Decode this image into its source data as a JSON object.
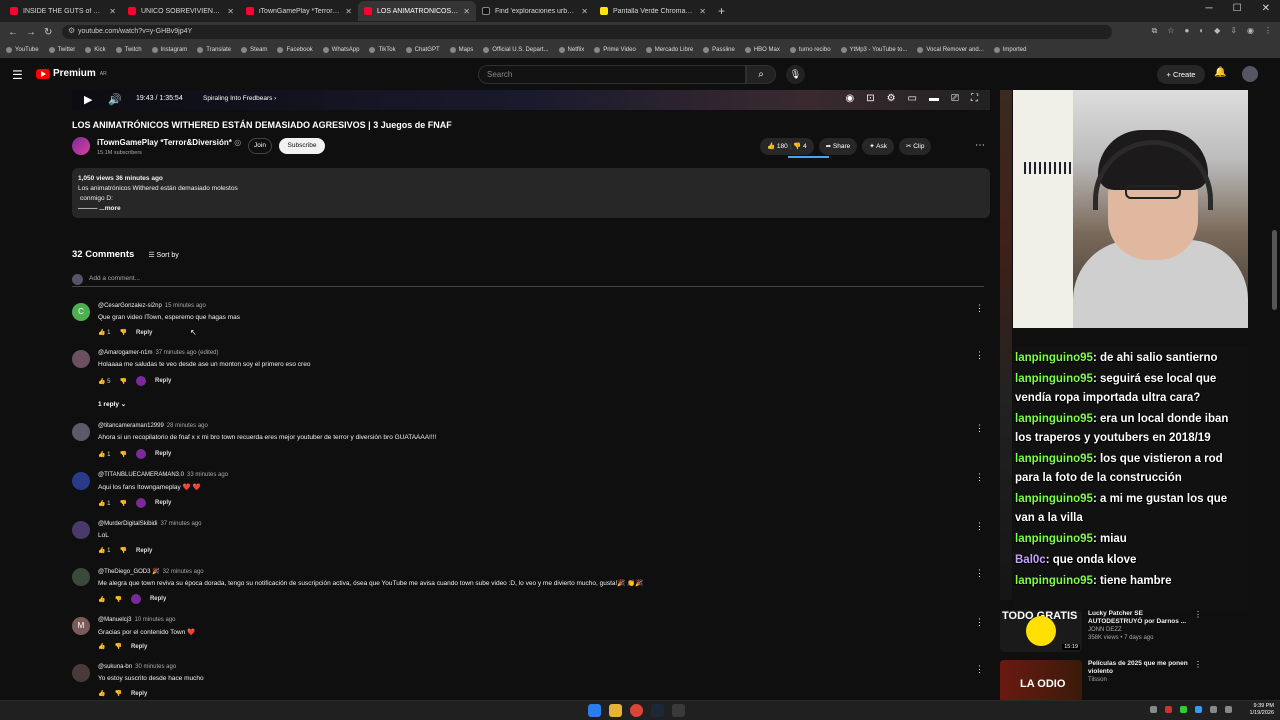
{
  "browser": {
    "tabs": [
      {
        "label": "INSIDE THE GUTS of THE CRAZ",
        "active": false
      },
      {
        "label": "UNICO SOBREVIVIENTE | ATRAP",
        "active": false
      },
      {
        "label": "iTownGamePlay *Terror&Diver",
        "active": false
      },
      {
        "label": "LOS ANIMATRÓNICOS WIT",
        "active": true
      },
      {
        "label": "Find 'exploraciones urbanas' or",
        "active": false
      },
      {
        "label": "Pantalla Verde Chroma | Merca",
        "active": false
      }
    ],
    "new_tab": "+",
    "url": "youtube.com/watch?v=y-GHBv9jp4Y",
    "bookmarks": [
      "YouTube",
      "Twitter",
      "Kick",
      "Twitch",
      "Instagram",
      "Translate",
      "Steam",
      "Facebook",
      "WhatsApp",
      "TikTok",
      "ChatGPT",
      "Maps",
      "Official U.S. Depart...",
      "Netflix",
      "Prime Video",
      "Mercado Libre",
      "Passline",
      "HBO Max",
      "turno recibo",
      "YtMp3 - YouTube to...",
      "Vocal Remover and...",
      "Imported"
    ]
  },
  "youtube": {
    "logo_text": "Premium",
    "logo_sup": "AR",
    "search_placeholder": "Search",
    "create_label": "+ Create"
  },
  "player": {
    "time": "19:43 / 1:35:54",
    "chapter": "Spiraling Into Fredbears ›"
  },
  "video": {
    "title": "LOS ANIMATRÓNICOS WITHERED ESTÁN DEMASIADO AGRESIVOS | 3 Juegos de FNAF",
    "channel": "iTownGamePlay *Terror&Diversión*",
    "verified": "◎",
    "subscribers": "15.1M subscribers",
    "join_label": "Join",
    "subscribe_label": "Subscribe",
    "likes": "180",
    "dislikes": "4",
    "share_label": "Share",
    "ask_label": "Ask",
    "clip_label": "Clip",
    "views_line": "1,050 views  36 minutes ago",
    "desc_line1": "Los animatrónicos Withered están demasiado molestos",
    "desc_line2": "conmigo D:",
    "desc_more": "———  ...more"
  },
  "comments_section": {
    "count_label": "32 Comments",
    "sort_label": "Sort by",
    "add_placeholder": "Add a comment...",
    "one_reply": "1 reply"
  },
  "comments": [
    {
      "avatar_letter": "C",
      "avatar_color": "#4caf50",
      "author": "@CesarGonzalez-si2np",
      "time": "15 minutes ago",
      "text": "Que gran video ITown, esperemo que hagas mas",
      "likes": "1",
      "reply": "Reply",
      "heart": false
    },
    {
      "avatar_letter": "",
      "avatar_color": "#6a5060",
      "author": "@Amarogamer-n1m",
      "time": "37 minutes ago (edited)",
      "text": "Holaaaa me saludas te veo desde ase un monton soy el primero eso creo",
      "likes": "5",
      "reply": "Reply",
      "heart": true
    },
    {
      "avatar_letter": "",
      "avatar_color": "#5a5a6a",
      "author": "@titancameraman12999",
      "time": "28 minutes ago",
      "text": "Ahora si un recopilatorio de fnaf x x mi bro town recuerda eres mejor youtuber de terror y diversión bro GUATAAAA!!!!",
      "likes": "1",
      "reply": "Reply",
      "heart": true
    },
    {
      "avatar_letter": "",
      "avatar_color": "#2a3a8a",
      "author": "@TITANBLUECAMERAMAN3.0",
      "time": "33 minutes ago",
      "text": "Aqui los fans Itowngameplay ❤️ ❤️",
      "likes": "1",
      "reply": "Reply",
      "heart": true
    },
    {
      "avatar_letter": "",
      "avatar_color": "#4a3a6a",
      "author": "@MurderDigitalSkibidi",
      "time": "37 minutes ago",
      "text": "LoL",
      "likes": "1",
      "reply": "Reply",
      "heart": false
    },
    {
      "avatar_letter": "",
      "avatar_color": "#3a4a3a",
      "author": "@TheDiego_GOD3 🎉",
      "time": "32 minutes ago",
      "text": "Me alegra que town reviva su época dorada, tengo su notificación de suscripción activa, ósea que YouTube me avisa cuando town sube video :D, lo veo y me divierto mucho, gusta!🎉 👏🎉",
      "likes": "",
      "reply": "Reply",
      "heart": true
    },
    {
      "avatar_letter": "M",
      "avatar_color": "#7a5a5a",
      "author": "@Manuelcj3",
      "time": "10 minutes ago",
      "text": "Gracias por el contenido Town ❤️",
      "likes": "",
      "reply": "Reply",
      "heart": false
    },
    {
      "avatar_letter": "",
      "avatar_color": "#4a3a3a",
      "author": "@sukuna-bn",
      "time": "30 minutes ago",
      "text": "Yo estoy suscrito desde hace mucho",
      "likes": "",
      "reply": "Reply",
      "heart": false
    }
  ],
  "stream_chat": [
    {
      "user": "lanpinguino95",
      "msg": ": de ahi salio santierno",
      "alt": false
    },
    {
      "user": "lanpinguino95",
      "msg": ": seguirá ese local que vendía ropa importada ultra cara?",
      "alt": false
    },
    {
      "user": "lanpinguino95",
      "msg": ": era un local donde iban los traperos y youtubers en 2018/19",
      "alt": false
    },
    {
      "user": "lanpinguino95",
      "msg": ": los que vistieron a rod para la foto de la construcción",
      "alt": false
    },
    {
      "user": "lanpinguino95",
      "msg": ": a mi me gustan los que van a la villa",
      "alt": false
    },
    {
      "user": "lanpinguino95",
      "msg": ": miau",
      "alt": false
    },
    {
      "user": "Bal0c",
      "msg": ": que onda klove",
      "alt": true
    },
    {
      "user": "lanpinguino95",
      "msg": ": tiene hambre",
      "alt": false
    }
  ],
  "related": [
    {
      "title": "Lucky Patcher SE AUTODESTRUYÓ por Darnos ...",
      "channel": "JONN DEZZ",
      "meta": "358K views • 7 days ago",
      "duration": "15:19",
      "thumb_text": "TODO GRATIS"
    },
    {
      "title": "Películas de 2025 que me ponen violento",
      "channel": "Tilsson",
      "meta": "",
      "duration": "",
      "thumb_text": "LA ODIO"
    }
  ],
  "taskbar": {
    "time": "9:39 PM",
    "date": "1/19/2026"
  }
}
